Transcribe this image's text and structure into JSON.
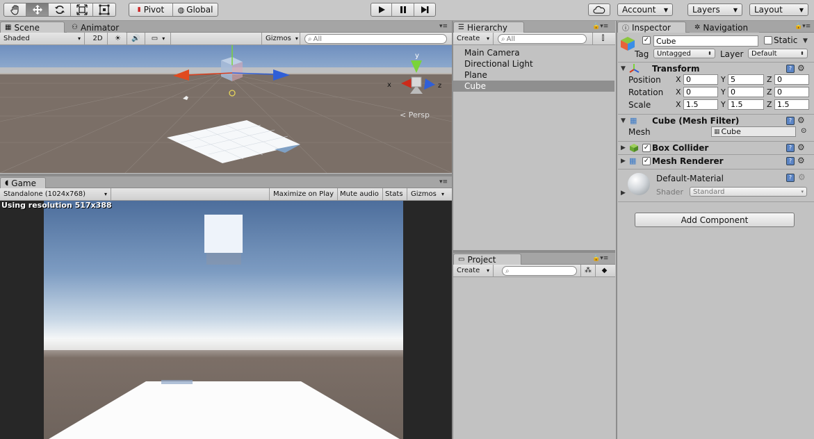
{
  "toolbar": {
    "pivot_label": "Pivot",
    "global_label": "Global",
    "account_label": "Account",
    "layers_label": "Layers",
    "layout_label": "Layout"
  },
  "scene": {
    "tab_label": "Scene",
    "animator_tab_label": "Animator",
    "shading_mode": "Shaded",
    "mode_2d_label": "2D",
    "gizmos_label": "Gizmos",
    "search_placeholder": "All",
    "gizmo_axis_x": "x",
    "gizmo_axis_y": "y",
    "gizmo_axis_z": "z",
    "persp_label": "Persp"
  },
  "game": {
    "tab_label": "Game",
    "aspect": "Standalone (1024x768)",
    "maximize_label": "Maximize on Play",
    "mute_label": "Mute audio",
    "stats_label": "Stats",
    "gizmos_label": "Gizmos",
    "resolution_text": "Using resolution 517x388"
  },
  "hierarchy": {
    "tab_label": "Hierarchy",
    "create_label": "Create",
    "search_placeholder": "All",
    "items": [
      {
        "label": "Main Camera"
      },
      {
        "label": "Directional Light"
      },
      {
        "label": "Plane"
      },
      {
        "label": "Cube"
      }
    ],
    "selected_index": 3
  },
  "project": {
    "tab_label": "Project",
    "create_label": "Create"
  },
  "inspector": {
    "tab_label": "Inspector",
    "navigation_tab_label": "Navigation",
    "object_name": "Cube",
    "static_label": "Static",
    "tag_label": "Tag",
    "tag_value": "Untagged",
    "layer_label": "Layer",
    "layer_value": "Default",
    "transform": {
      "title": "Transform",
      "position_label": "Position",
      "rotation_label": "Rotation",
      "scale_label": "Scale",
      "x_label": "X",
      "y_label": "Y",
      "z_label": "Z",
      "position": {
        "x": "0",
        "y": "5",
        "z": "0"
      },
      "rotation": {
        "x": "0",
        "y": "0",
        "z": "0"
      },
      "scale": {
        "x": "1.5",
        "y": "1.5",
        "z": "1.5"
      }
    },
    "mesh_filter": {
      "title": "Cube (Mesh Filter)",
      "mesh_label": "Mesh",
      "mesh_value": "Cube"
    },
    "box_collider": {
      "title": "Box Collider"
    },
    "mesh_renderer": {
      "title": "Mesh Renderer"
    },
    "material": {
      "name": "Default-Material",
      "shader_label": "Shader",
      "shader_value": "Standard"
    },
    "add_component_label": "Add Component"
  },
  "colors": {
    "accent_selected": "#8f8f8f",
    "axis_x": "#d83a1a",
    "axis_y": "#7ad33a",
    "axis_z": "#2f5fd8"
  }
}
